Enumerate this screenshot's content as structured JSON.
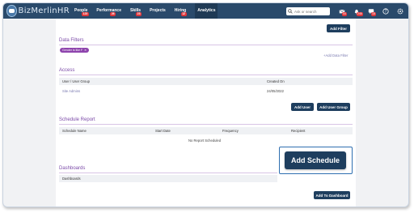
{
  "app": {
    "logo_text": "BizMerlinHR"
  },
  "nav": {
    "items": [
      {
        "label": "People",
        "badge": "123"
      },
      {
        "label": "Performance",
        "badge": "26"
      },
      {
        "label": "Skills",
        "badge": "23"
      },
      {
        "label": "Projects",
        "badge": ""
      },
      {
        "label": "Hiring",
        "badge": "12"
      },
      {
        "label": "Analytics",
        "badge": ""
      }
    ]
  },
  "search": {
    "placeholder": "Ask or search"
  },
  "top_icons": [
    {
      "name": "mail-icon",
      "badge": "44"
    },
    {
      "name": "bell-icon",
      "badge": "246"
    },
    {
      "name": "chat-icon",
      "badge": "18"
    },
    {
      "name": "help-icon",
      "badge": ""
    },
    {
      "name": "settings-icon",
      "badge": ""
    },
    {
      "name": "power-icon",
      "badge": ""
    }
  ],
  "toolbar": {
    "add_filter_label": "Add Filter"
  },
  "data_filters": {
    "title": "Data Filters",
    "chip_label": "Gender is like F",
    "add_link": "+Add Data Filter"
  },
  "access": {
    "title": "Access",
    "columns": [
      "User / User Group",
      "Created On"
    ],
    "rows": [
      {
        "user": "Site Admins",
        "created_on": "24/05/2022"
      }
    ],
    "add_user_label": "Add User",
    "add_user_group_label": "Add User Group"
  },
  "schedule_report": {
    "title": "Schedule Report",
    "columns": [
      "Schedule Name",
      "Start Date",
      "Frequency",
      "Recipient"
    ],
    "empty_text": "No Report Scheduled",
    "add_schedule_label": "Add Schedule"
  },
  "dashboards": {
    "title": "Dashboards",
    "columns": [
      "Dashboards"
    ],
    "add_to_dashboard_label": "Add To Dashboard"
  }
}
